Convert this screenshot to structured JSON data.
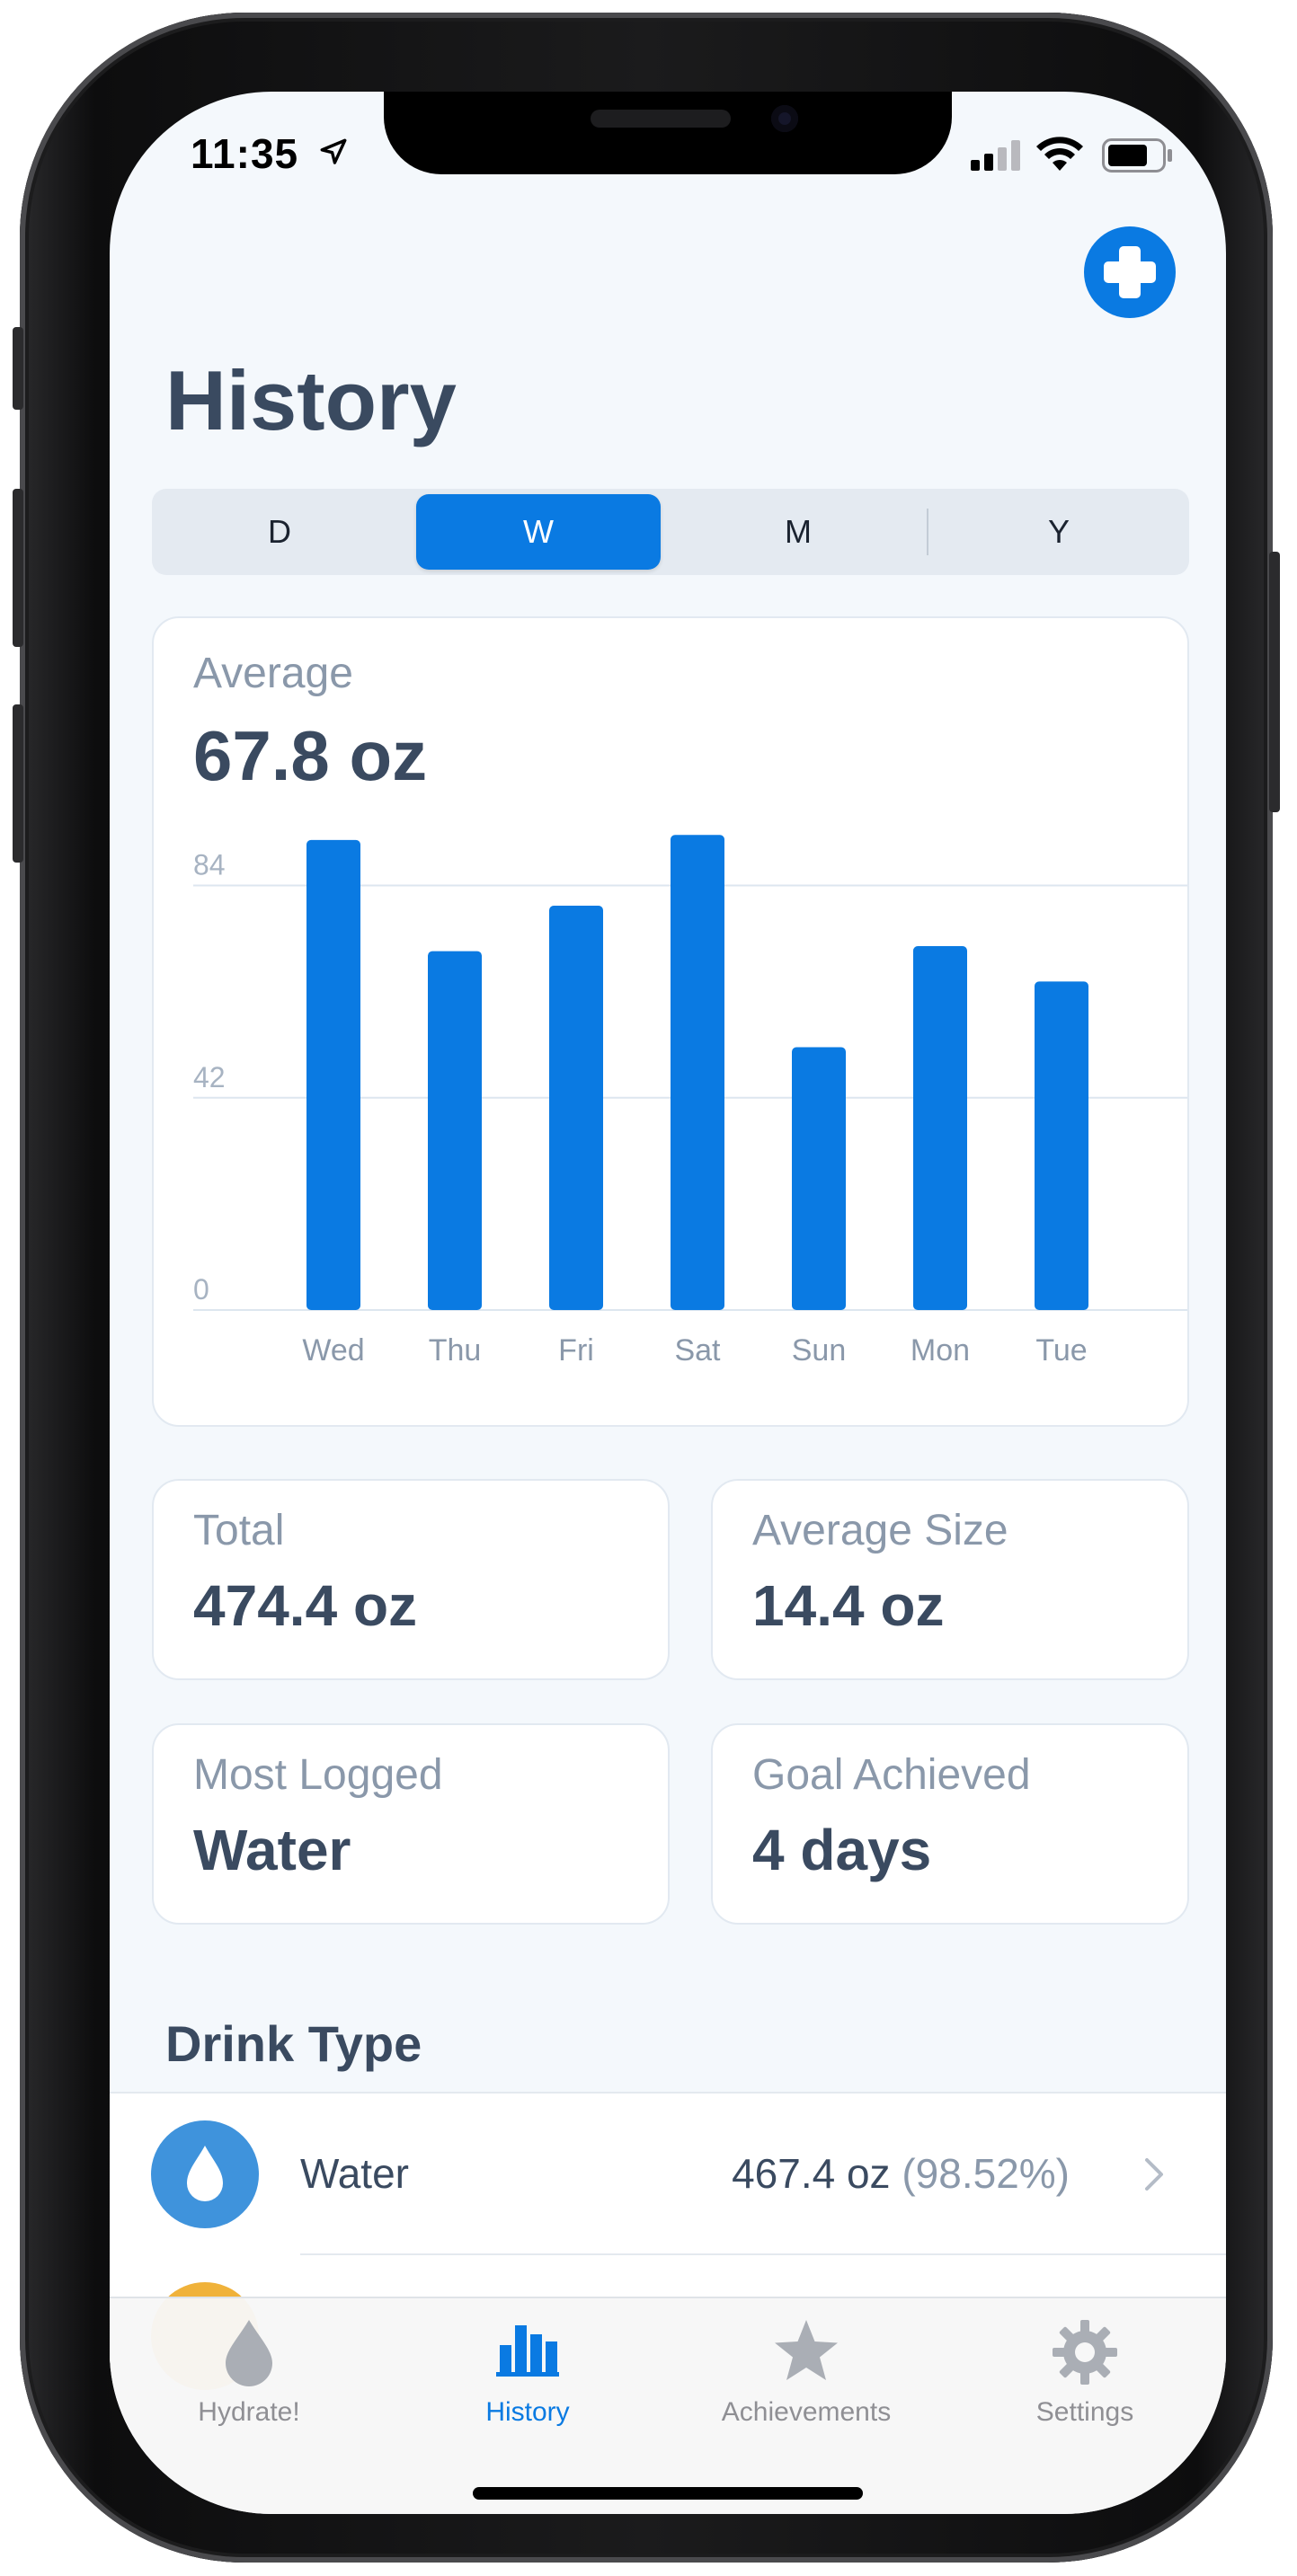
{
  "status_bar": {
    "time": "11:35"
  },
  "header": {
    "title": "History"
  },
  "segments": [
    {
      "label": "D",
      "active": false
    },
    {
      "label": "W",
      "active": true
    },
    {
      "label": "M",
      "active": false
    },
    {
      "label": "Y",
      "active": false
    }
  ],
  "summary": {
    "average_label": "Average",
    "average_value": "67.8 oz"
  },
  "chart_data": {
    "type": "bar",
    "categories": [
      "Wed",
      "Thu",
      "Fri",
      "Sat",
      "Sun",
      "Mon",
      "Tue"
    ],
    "values": [
      93,
      71,
      80,
      94,
      52,
      72,
      65
    ],
    "yticks": [
      0,
      42,
      84
    ],
    "ylim": [
      0,
      96
    ],
    "grid": true,
    "bar_color": "#0a7ae2"
  },
  "stats": {
    "total_label": "Total",
    "total_value": "474.4 oz",
    "avg_size_label": "Average Size",
    "avg_size_value": "14.4 oz",
    "most_logged_label": "Most Logged",
    "most_logged_value": "Water",
    "goal_label": "Goal Achieved",
    "goal_value": "4 days"
  },
  "drink_type": {
    "title": "Drink Type",
    "items": [
      {
        "name": "Water",
        "amount": "467.4 oz",
        "percent": "(98.52%)",
        "icon": "water-drop-icon",
        "color": "#3f93dc"
      }
    ]
  },
  "tab_bar": {
    "tabs": [
      {
        "label": "Hydrate!",
        "icon": "drop-icon",
        "active": false
      },
      {
        "label": "History",
        "icon": "bar-chart-icon",
        "active": true
      },
      {
        "label": "Achievements",
        "icon": "star-icon",
        "active": false
      },
      {
        "label": "Settings",
        "icon": "gear-icon",
        "active": false
      }
    ]
  },
  "colors": {
    "accent": "#0a7ae2",
    "text_dark": "#3a4a60",
    "text_muted": "#8a98aa",
    "background": "#f4f8fc"
  }
}
